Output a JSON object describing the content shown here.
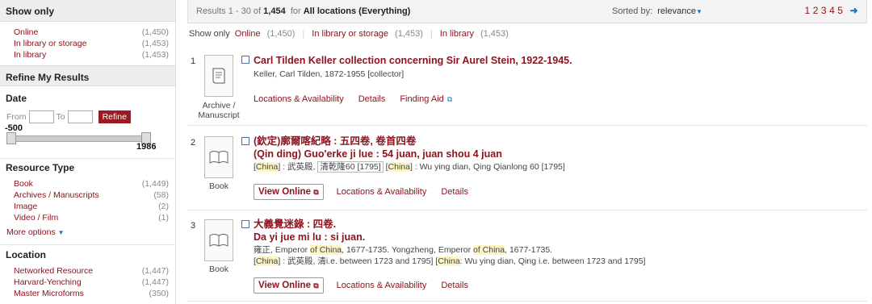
{
  "sidebar": {
    "show_only_title": "Show only",
    "show_only_items": [
      {
        "label": "Online",
        "count": "(1,450)"
      },
      {
        "label": "In library or storage",
        "count": "(1,453)"
      },
      {
        "label": "In library",
        "count": "(1,453)"
      }
    ],
    "refine_title": "Refine My Results",
    "date": {
      "title": "Date",
      "from_label": "From",
      "to_label": "To",
      "refine_button": "Refine",
      "min": "-500",
      "max": "1986"
    },
    "resource_type": {
      "title": "Resource Type",
      "items": [
        {
          "label": "Book",
          "count": "(1,449)"
        },
        {
          "label": "Archives / Manuscripts",
          "count": "(58)"
        },
        {
          "label": "Image",
          "count": "(2)"
        },
        {
          "label": "Video / Film",
          "count": "(1)"
        }
      ],
      "more": "More options"
    },
    "location": {
      "title": "Location",
      "items": [
        {
          "label": "Networked Resource",
          "count": "(1,447)"
        },
        {
          "label": "Harvard-Yenching",
          "count": "(1,447)"
        },
        {
          "label": "Master Microforms",
          "count": "(350)"
        }
      ]
    }
  },
  "results_bar": {
    "prefix": "Results 1 - 30 of",
    "total": "1,454",
    "for_text": "for",
    "scope": "All locations (Everything)",
    "sorted_label": "Sorted by:",
    "sorted_value": "relevance",
    "pages": [
      "1",
      "2",
      "3",
      "4",
      "5"
    ]
  },
  "show_only_bar": {
    "label": "Show only",
    "items": [
      {
        "label": "Online",
        "count": "(1,450)"
      },
      {
        "label": "In library or storage",
        "count": "(1,453)"
      },
      {
        "label": "In library",
        "count": "(1,453)"
      }
    ]
  },
  "results": [
    {
      "num": "1",
      "type_line1": "Archive /",
      "type_line2": "Manuscript",
      "title": "Carl Tilden Keller collection concerning Sir Aurel Stein, 1922-1945.",
      "author": "Keller, Carl Tilden, 1872-1955 [collector]",
      "actions": [
        "Locations & Availability",
        "Details",
        "Finding Aid"
      ]
    },
    {
      "num": "2",
      "type": "Book",
      "title_cjk": "(欽定)廓爾喀紀略 : 五四卷, 卷首四卷",
      "title_rom": "(Qin ding) Guo'erke ji lue : 54 juan, juan shou 4 juan",
      "pub_a": "China",
      "pub_b": " : 武英殿, ",
      "pub_c": "清乾隆60 [1795]",
      "pub_d": "China",
      "pub_e": " : Wu ying dian, Qing Qianlong 60 [1795]",
      "view_online": "View Online",
      "actions": [
        "Locations & Availability",
        "Details"
      ]
    },
    {
      "num": "3",
      "type": "Book",
      "title_cjk": "大義覺迷錄 : 四卷.",
      "title_rom": "Da yi jue mi lu : si juan.",
      "auth_a": "雍正, Emperor ",
      "auth_b": "of China",
      "auth_c": ", 1677-1735. Yongzheng, Emperor ",
      "auth_d": "of China",
      "auth_e": ", 1677-1735.",
      "pub_a": "China",
      "pub_b": " : 武英殿, 清i.e. between 1723 and 1795] [",
      "pub_c": "China",
      "pub_d": ": Wu ying dian, Qing i.e. between 1723 and 1795]",
      "view_online": "View Online",
      "actions": [
        "Locations & Availability",
        "Details"
      ]
    }
  ]
}
